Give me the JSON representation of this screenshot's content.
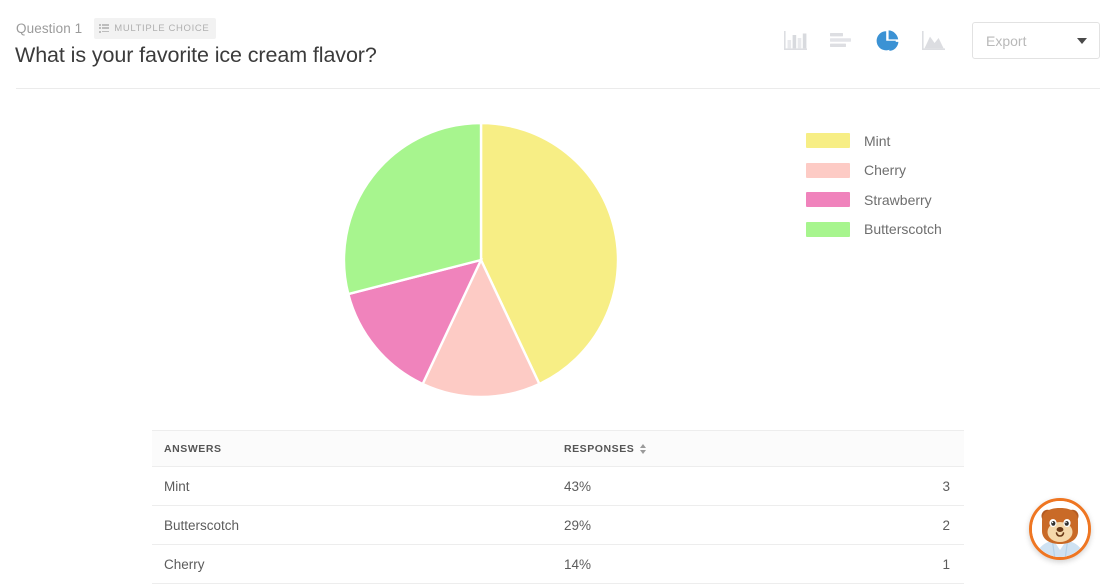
{
  "header": {
    "question_number": "Question 1",
    "badge_label": "MULTIPLE CHOICE",
    "title": "What is your favorite ice cream flavor?"
  },
  "toolbar": {
    "chart_buttons": [
      {
        "name": "column-chart-icon",
        "label": "Column chart",
        "active": false
      },
      {
        "name": "bar-chart-icon",
        "label": "Bar chart",
        "active": false
      },
      {
        "name": "pie-chart-icon",
        "label": "Pie chart",
        "active": true
      },
      {
        "name": "area-chart-icon",
        "label": "Area chart",
        "active": false
      }
    ],
    "export_label": "Export",
    "active_color": "#3b92d4",
    "inactive_color": "#dddee2"
  },
  "legend": [
    {
      "label": "Mint",
      "color": "#f7ee85"
    },
    {
      "label": "Cherry",
      "color": "#fdcbc5"
    },
    {
      "label": "Strawberry",
      "color": "#f083bc"
    },
    {
      "label": "Butterscotch",
      "color": "#a7f58e"
    }
  ],
  "table": {
    "columns": [
      "ANSWERS",
      "RESPONSES"
    ],
    "rows": [
      {
        "answer": "Mint",
        "percent": "43%",
        "count": "3"
      },
      {
        "answer": "Butterscotch",
        "percent": "29%",
        "count": "2"
      },
      {
        "answer": "Cherry",
        "percent": "14%",
        "count": "1"
      }
    ]
  },
  "chat": {
    "avatar_name": "bear-mascot-avatar",
    "ring_color": "#ef7622"
  },
  "chart_data": {
    "type": "pie",
    "title": "What is your favorite ice cream flavor?",
    "categories": [
      "Mint",
      "Cherry",
      "Strawberry",
      "Butterscotch"
    ],
    "values": [
      43,
      14,
      14,
      29
    ],
    "counts": [
      3,
      1,
      1,
      2
    ],
    "colors": [
      "#f7ee85",
      "#fdcbc5",
      "#f083bc",
      "#a7f58e"
    ],
    "unit": "%",
    "start_angle": 0,
    "direction": "clockwise",
    "legend_position": "right",
    "grid": false,
    "xlabel": "",
    "ylabel": ""
  }
}
